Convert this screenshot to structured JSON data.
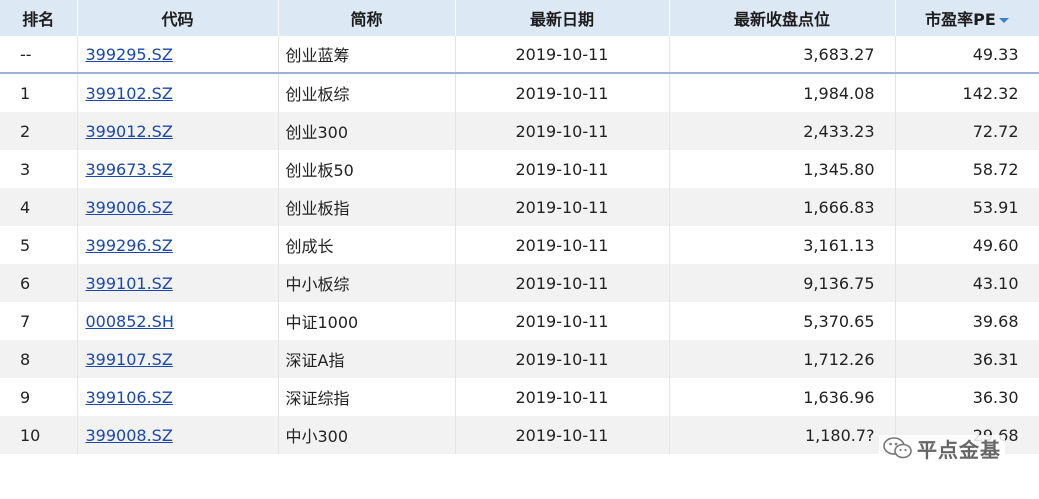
{
  "columns": [
    "排名",
    "代码",
    "简称",
    "最新日期",
    "最新收盘点位",
    "市盈率PE"
  ],
  "sort_indicator": "descending",
  "rows": [
    {
      "rank": "--",
      "code": "399295.SZ",
      "name": "创业蓝筹",
      "date": "2019-10-11",
      "close": "3,683.27",
      "pe": "49.33"
    },
    {
      "rank": "1",
      "code": "399102.SZ",
      "name": "创业板综",
      "date": "2019-10-11",
      "close": "1,984.08",
      "pe": "142.32"
    },
    {
      "rank": "2",
      "code": "399012.SZ",
      "name": "创业300",
      "date": "2019-10-11",
      "close": "2,433.23",
      "pe": "72.72"
    },
    {
      "rank": "3",
      "code": "399673.SZ",
      "name": "创业板50",
      "date": "2019-10-11",
      "close": "1,345.80",
      "pe": "58.72"
    },
    {
      "rank": "4",
      "code": "399006.SZ",
      "name": "创业板指",
      "date": "2019-10-11",
      "close": "1,666.83",
      "pe": "53.91"
    },
    {
      "rank": "5",
      "code": "399296.SZ",
      "name": "创成长",
      "date": "2019-10-11",
      "close": "3,161.13",
      "pe": "49.60"
    },
    {
      "rank": "6",
      "code": "399101.SZ",
      "name": "中小板综",
      "date": "2019-10-11",
      "close": "9,136.75",
      "pe": "43.10"
    },
    {
      "rank": "7",
      "code": "000852.SH",
      "name": "中证1000",
      "date": "2019-10-11",
      "close": "5,370.65",
      "pe": "39.68"
    },
    {
      "rank": "8",
      "code": "399107.SZ",
      "name": "深证A指",
      "date": "2019-10-11",
      "close": "1,712.26",
      "pe": "36.31"
    },
    {
      "rank": "9",
      "code": "399106.SZ",
      "name": "深证综指",
      "date": "2019-10-11",
      "close": "1,636.96",
      "pe": "36.30"
    },
    {
      "rank": "10",
      "code": "399008.SZ",
      "name": "中小300",
      "date": "2019-10-11",
      "close": "1,180.7?",
      "pe": "29.68"
    }
  ],
  "watermark": {
    "text": "平点金基",
    "icon": "wechat-icon"
  },
  "colors": {
    "header_bg": "#dde8f5",
    "link": "#1a47b0",
    "row_alt": "#f2f2f2",
    "sort_arrow": "#3a7fd5"
  }
}
